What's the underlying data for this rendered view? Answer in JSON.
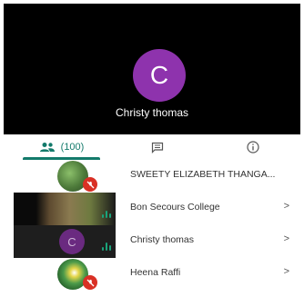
{
  "stage": {
    "avatar_initial": "C",
    "participant_name": "Christy thomas",
    "avatar_color": "#8e33ad"
  },
  "tabs": {
    "people_count": "(100)",
    "accent": "#137a6b"
  },
  "participants": [
    {
      "name": "SWEETY ELIZABETH THANGA...",
      "muted": true
    },
    {
      "name": "Bon Secours College",
      "chevron": ">",
      "speaking": true
    },
    {
      "name": "Christy thomas",
      "chevron": ">",
      "initial": "C",
      "speaking": true
    },
    {
      "name": "Heena Raffi",
      "chevron": ">",
      "muted": true
    }
  ]
}
